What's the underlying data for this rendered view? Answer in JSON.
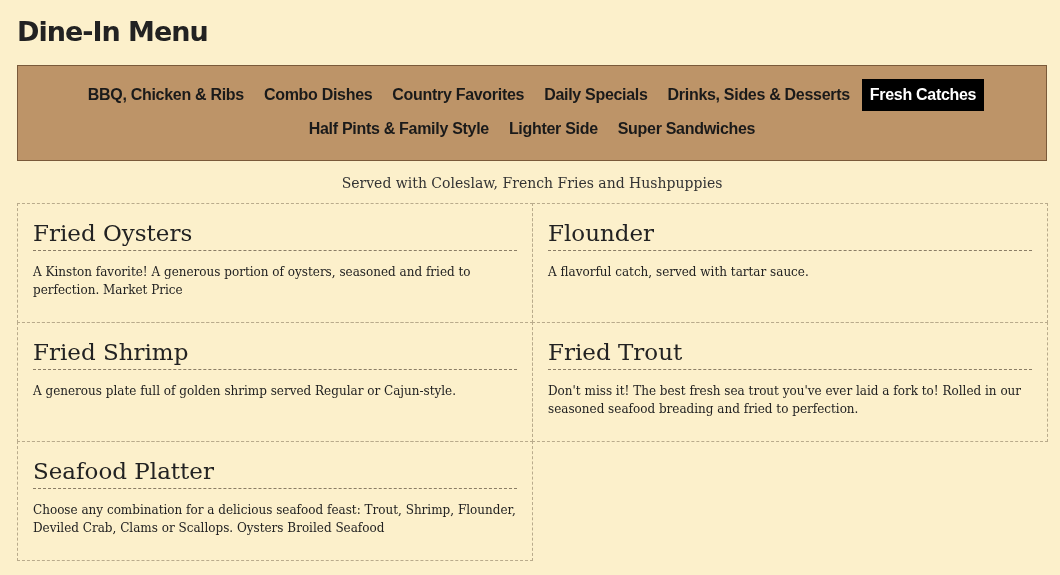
{
  "title": "Dine-In Menu",
  "tabs": [
    {
      "label": "BBQ, Chicken & Ribs",
      "selected": false
    },
    {
      "label": "Combo Dishes",
      "selected": false
    },
    {
      "label": "Country Favorites",
      "selected": false
    },
    {
      "label": "Daily Specials",
      "selected": false
    },
    {
      "label": "Drinks, Sides & Desserts",
      "selected": false
    },
    {
      "label": "Fresh Catches",
      "selected": true
    },
    {
      "label": "Half Pints & Family Style",
      "selected": false
    },
    {
      "label": "Lighter Side",
      "selected": false
    },
    {
      "label": "Super Sandwiches",
      "selected": false
    }
  ],
  "note": "Served with Coleslaw, French Fries and Hushpuppies",
  "items": [
    {
      "name": "Fried Oysters",
      "description": "A Kinston favorite! A generous portion of oysters, seasoned and fried to perfection. Market Price"
    },
    {
      "name": "Flounder",
      "description": "A flavorful catch, served with tartar sauce."
    },
    {
      "name": "Fried Shrimp",
      "description": "A generous plate full of golden shrimp served Regular or Cajun-style."
    },
    {
      "name": "Fried Trout",
      "description": "Don't miss it! The best fresh sea trout you've ever laid a fork to! Rolled in our seasoned seafood breading and fried to perfection."
    },
    {
      "name": "Seafood Platter",
      "description": "Choose any combination for a delicious seafood feast: Trout, Shrimp, Flounder, Deviled Crab, Clams or Scallops. Oysters Broiled Seafood"
    }
  ]
}
